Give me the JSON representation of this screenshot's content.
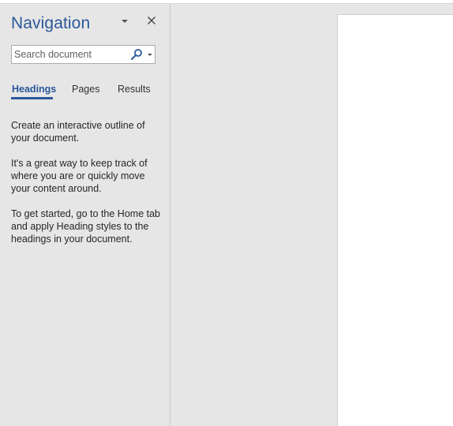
{
  "navigation": {
    "title": "Navigation",
    "search": {
      "placeholder": "Search document",
      "value": ""
    },
    "tabs": [
      {
        "label": "Headings",
        "active": true
      },
      {
        "label": "Pages",
        "active": false
      },
      {
        "label": "Results",
        "active": false
      }
    ],
    "help": [
      "Create an interactive outline of your document.",
      "It's a great way to keep track of where you are or quickly move your content around.",
      "To get started, go to the Home tab and apply Heading styles to the headings in your document."
    ],
    "icons": {
      "options": "chevron-down-icon",
      "close": "close-icon",
      "search": "search-icon",
      "search_dropdown": "small-chevron-down-icon"
    }
  },
  "colors": {
    "accent": "#2b579a",
    "pane_background": "#e6e6e6",
    "page": "#ffffff"
  }
}
